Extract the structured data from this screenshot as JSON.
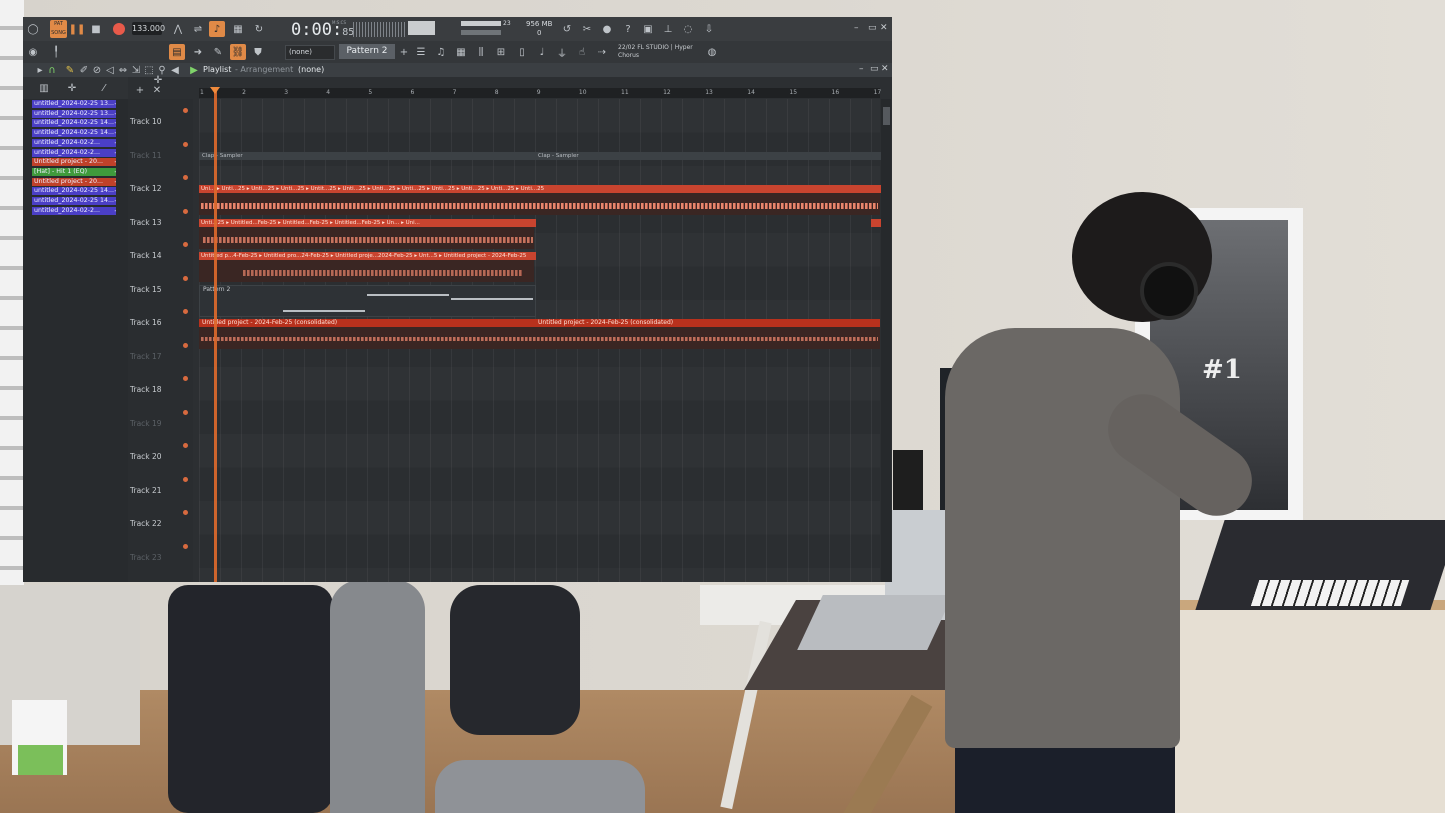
{
  "toolbar": {
    "tempo": "133.000",
    "time_main": "0:00:",
    "time_small": "85",
    "time_label": "M:S:CS",
    "cpu_num": "23",
    "memory": "956 MB",
    "memory2": "0",
    "snap_value": "(none)",
    "pattern": "Pattern 2",
    "news_line1": "22/02  FL STUDIO | Hyper",
    "news_line2": "Chorus",
    "mode_label": "PAT",
    "mode_label2": "SONG"
  },
  "playlist": {
    "title": "Playlist",
    "subtitle": "- Arrangement",
    "snap": "(none)"
  },
  "browser": {
    "items": [
      {
        "label": "untitled_2024-02-25 13...",
        "color": "#4b3fc6"
      },
      {
        "label": "untitled_2024-02-25 13...",
        "color": "#4b3fc6"
      },
      {
        "label": "untitled_2024-02-25 14...",
        "color": "#4b3fc6"
      },
      {
        "label": "untitled_2024-02-25 14...",
        "color": "#4b3fc6"
      },
      {
        "label": "untitled_2024-02-2...",
        "color": "#4b3fc6"
      },
      {
        "label": "untitled_2024-02-2...",
        "color": "#4b3fc6"
      },
      {
        "label": "Untitled project - 20...",
        "color": "#c0412a"
      },
      {
        "label": "[Hat] - Hit 1 (EQ)",
        "color": "#3f9a3c"
      },
      {
        "label": "Untitled project - 20...",
        "color": "#c0412a"
      },
      {
        "label": "untitled_2024-02-25 14...",
        "color": "#4b3fc6"
      },
      {
        "label": "untitled_2024-02-25 14...",
        "color": "#4b3fc6"
      },
      {
        "label": "untitled_2024-02-2...",
        "color": "#4b3fc6"
      }
    ]
  },
  "ruler": {
    "bars": [
      "1",
      "2",
      "3",
      "4",
      "5",
      "6",
      "7",
      "8",
      "9",
      "10",
      "11",
      "12",
      "13",
      "14",
      "15",
      "16",
      "17"
    ]
  },
  "tracks": [
    {
      "name": "Track 10",
      "dim": false
    },
    {
      "name": "Track 11",
      "dim": true
    },
    {
      "name": "Track 12",
      "dim": false
    },
    {
      "name": "Track 13",
      "dim": false
    },
    {
      "name": "Track 14",
      "dim": false
    },
    {
      "name": "Track 15",
      "dim": false
    },
    {
      "name": "Track 16",
      "dim": false
    },
    {
      "name": "Track 17",
      "dim": true
    },
    {
      "name": "Track 18",
      "dim": false
    },
    {
      "name": "Track 19",
      "dim": true
    },
    {
      "name": "Track 20",
      "dim": false
    },
    {
      "name": "Track 21",
      "dim": false
    },
    {
      "name": "Track 22",
      "dim": false
    },
    {
      "name": "Track 23",
      "dim": true
    }
  ],
  "clips": {
    "auto1": "Clap - Sampler",
    "auto2": "Clap - Sampler",
    "t12": "Uni... ▸ Unti...25 ▸ Unti...25 ▸ Unti...25 ▸ Untit...25 ▸ Unti...25 ▸ Unti...25 ▸ Unti...25 ▸ Unti...25 ▸ Unti...25 ▸ Unti...25 ▸ Unti...25",
    "t13": "Unti...25 ▸ Untitled...Feb-25 ▸ Untitled...Feb-25 ▸ Untitled...Feb-25 ▸ Un... ▸ Uni...",
    "t14": "Untitled p...4-Feb-25 ▸ Untitled pro...24-Feb-25 ▸ Untitled proje...2024-Feb-25 ▸ Unt...5 ▸ Untitled project - 2024-Feb-25",
    "t15": "Pattern 2",
    "t16a": "Untitled project - 2024-Feb-25 (consolidated)",
    "t16b": "Untitled project - 2024-Feb-25 (consolidated)"
  },
  "scene": {
    "poster_text": "#1"
  },
  "colors": {
    "accent": "#e08a47",
    "clip_red": "#c9442f",
    "playhead": "#e06a2c"
  }
}
